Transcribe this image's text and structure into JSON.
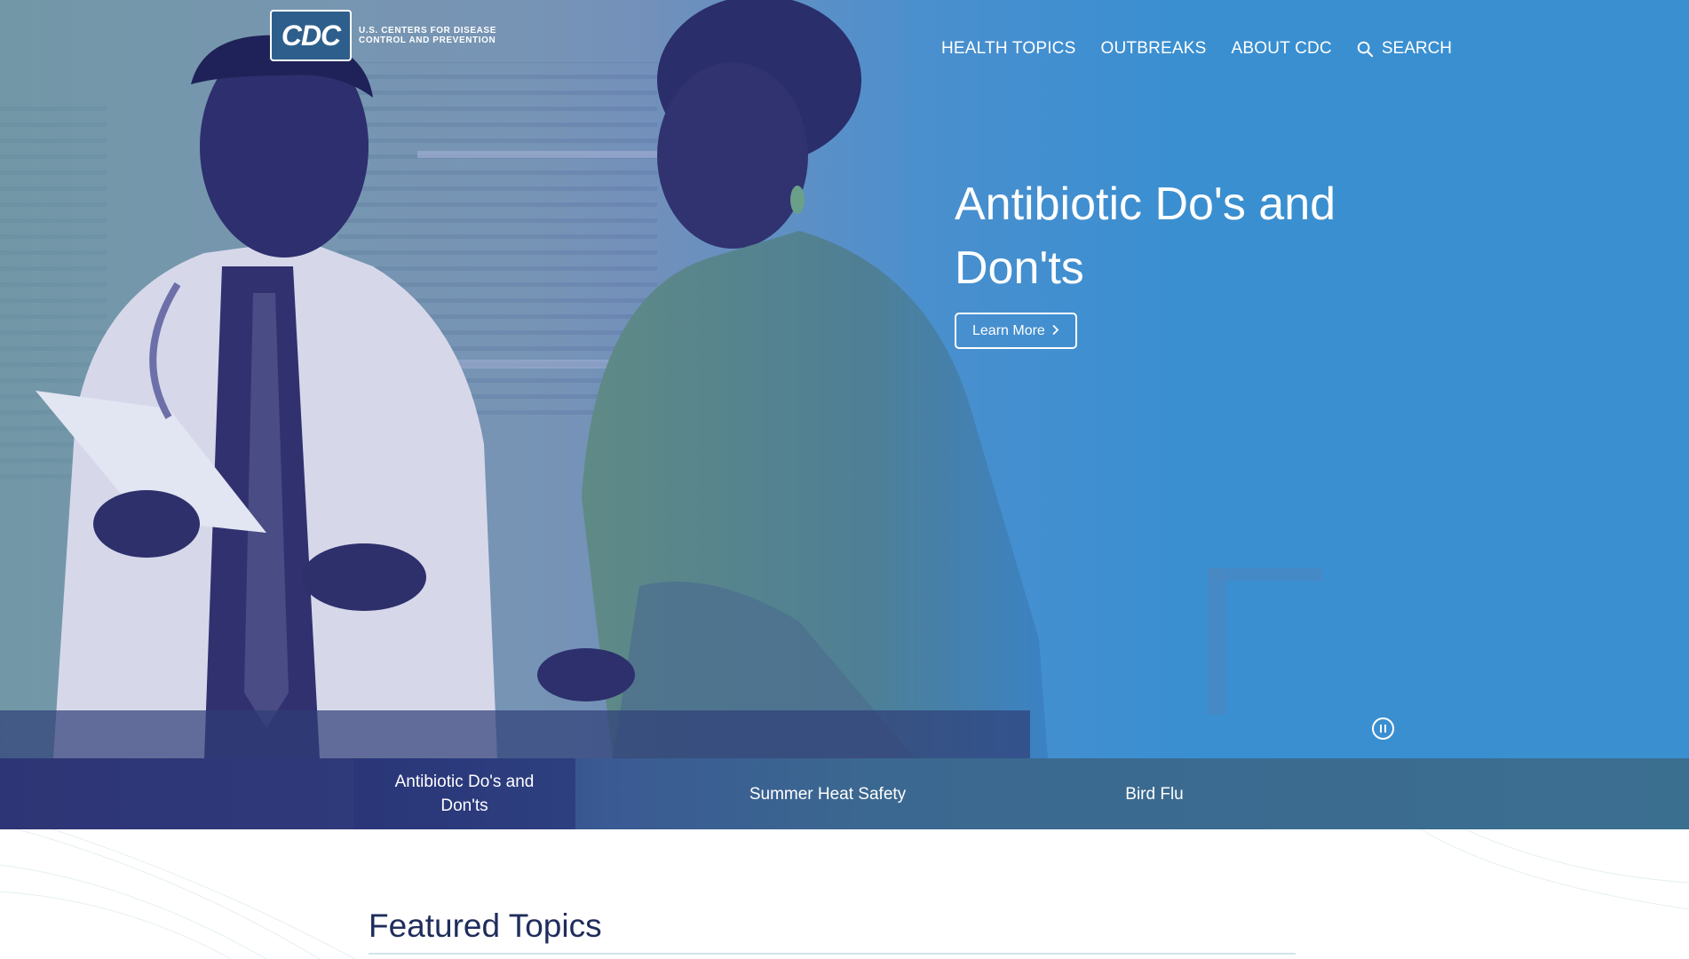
{
  "header": {
    "logo_mark": "CDC",
    "logo_text_line1": "U.S. CENTERS FOR DISEASE",
    "logo_text_line2": "CONTROL AND PREVENTION",
    "nav": [
      {
        "label": "HEALTH TOPICS"
      },
      {
        "label": "OUTBREAKS"
      },
      {
        "label": "ABOUT CDC"
      }
    ],
    "search_label": "SEARCH"
  },
  "hero": {
    "title": "Antibiotic Do's and Don'ts",
    "button_label": "Learn More",
    "button_icon": "chevron-right-icon",
    "pause_icon": "pause-icon"
  },
  "carousel_tabs": [
    {
      "label": "Antibiotic Do's and Don'ts",
      "active": true
    },
    {
      "label": "Summer Heat Safety",
      "active": false
    },
    {
      "label": "Bird Flu",
      "active": false
    }
  ],
  "featured": {
    "heading": "Featured Topics"
  },
  "colors": {
    "hero_blue": "#3a8fd0",
    "hero_navy": "#2e3576",
    "tab_bar": "#3b6f90",
    "heading_navy": "#1f2d5c"
  }
}
